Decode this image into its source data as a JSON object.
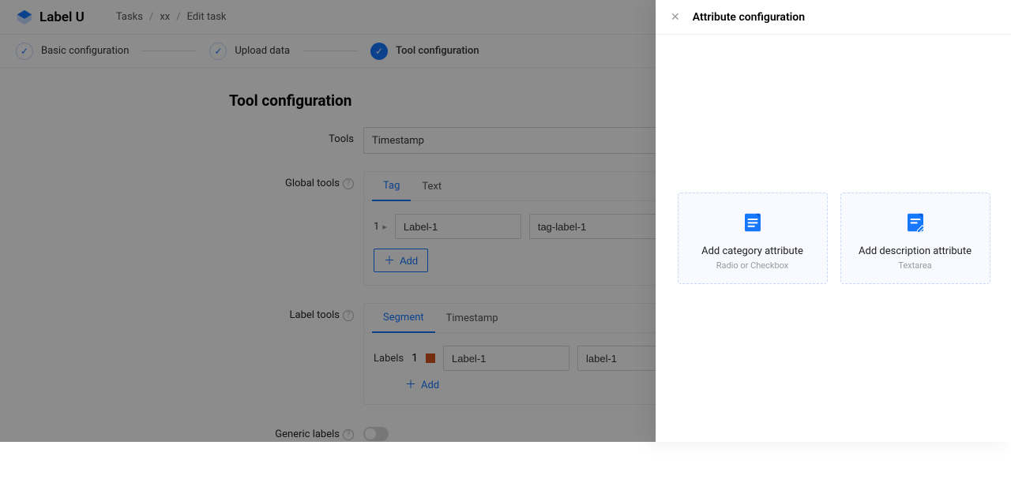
{
  "brand": "Label U",
  "breadcrumbs": {
    "root": "Tasks",
    "mid": "xx",
    "leaf": "Edit task"
  },
  "steps": {
    "basic": "Basic configuration",
    "upload": "Upload data",
    "tool": "Tool configuration"
  },
  "page_title": "Tool configuration",
  "form": {
    "tools_label": "Tools",
    "tools_value": "Timestamp",
    "global_tools_label": "Global tools",
    "label_tools_label": "Label tools",
    "labels_label": "Labels",
    "generic_labels_label": "Generic labels"
  },
  "global_tools_panel": {
    "tabs": {
      "tag": "Tag",
      "text": "Text"
    },
    "row": {
      "index": "1",
      "name": "Label-1",
      "value": "tag-label-1"
    },
    "add_btn": "Add"
  },
  "label_tools_panel": {
    "tabs": {
      "segment": "Segment",
      "timestamp": "Timestamp"
    },
    "labels": {
      "index": "1",
      "name": "Label-1",
      "value": "label-1"
    },
    "add_link": "Add"
  },
  "drawer": {
    "title": "Attribute configuration",
    "category_card": {
      "title": "Add category attribute",
      "sub": "Radio or Checkbox"
    },
    "description_card": {
      "title": "Add description attribute",
      "sub": "Textarea"
    }
  }
}
